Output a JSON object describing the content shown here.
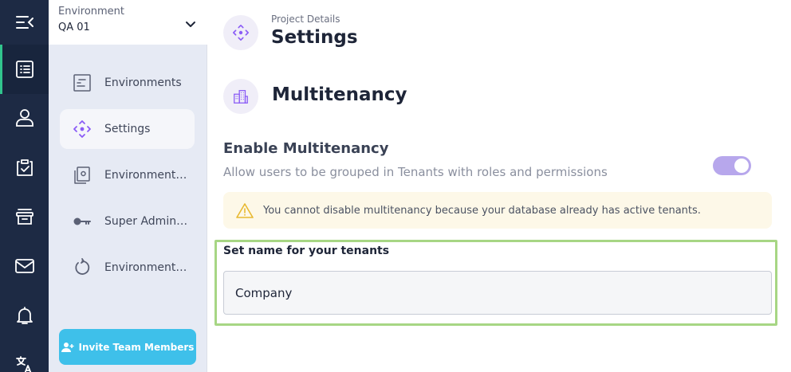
{
  "rail": {
    "items": [
      {
        "icon": "collapse-menu-icon"
      },
      {
        "icon": "document-list-icon",
        "active": true
      },
      {
        "icon": "user-icon"
      },
      {
        "icon": "clipboard-check-icon"
      },
      {
        "icon": "archive-icon"
      },
      {
        "icon": "mail-icon"
      },
      {
        "icon": "bell-icon"
      },
      {
        "icon": "translate-icon"
      }
    ]
  },
  "environment": {
    "label": "Environment",
    "value": "QA 01"
  },
  "subnav": {
    "items": [
      {
        "label": "Environments",
        "icon": "environments-icon",
        "active": false
      },
      {
        "label": "Settings",
        "icon": "settings-move-icon",
        "active": true
      },
      {
        "label": "Environment S...",
        "icon": "environment-secrets-icon",
        "active": false
      },
      {
        "label": "Super Admin T...",
        "icon": "key-icon",
        "active": false
      },
      {
        "label": "Environment Fl...",
        "icon": "refresh-icon",
        "active": false
      }
    ],
    "invite_label": "Invite Team Members"
  },
  "header": {
    "breadcrumb": "Project Details",
    "title": "Settings"
  },
  "section": {
    "title": "Multitenancy"
  },
  "multitenancy": {
    "enable_title": "Enable Multitenancy",
    "enable_description": "Allow users to be grouped in Tenants with roles and permissions",
    "enabled": true,
    "warning": "You cannot disable multitenancy because your database already has active tenants.",
    "tenant_name_label": "Set name for your tenants",
    "tenant_name_value": "Company"
  },
  "colors": {
    "rail_bg": "#1d2a44",
    "accent_purple": "#8b5cf6",
    "toggle_on": "#b7a7ec",
    "invite_button": "#3ec0ea",
    "highlight_border": "#a7d684",
    "warning_bg": "#fdf8e8"
  }
}
